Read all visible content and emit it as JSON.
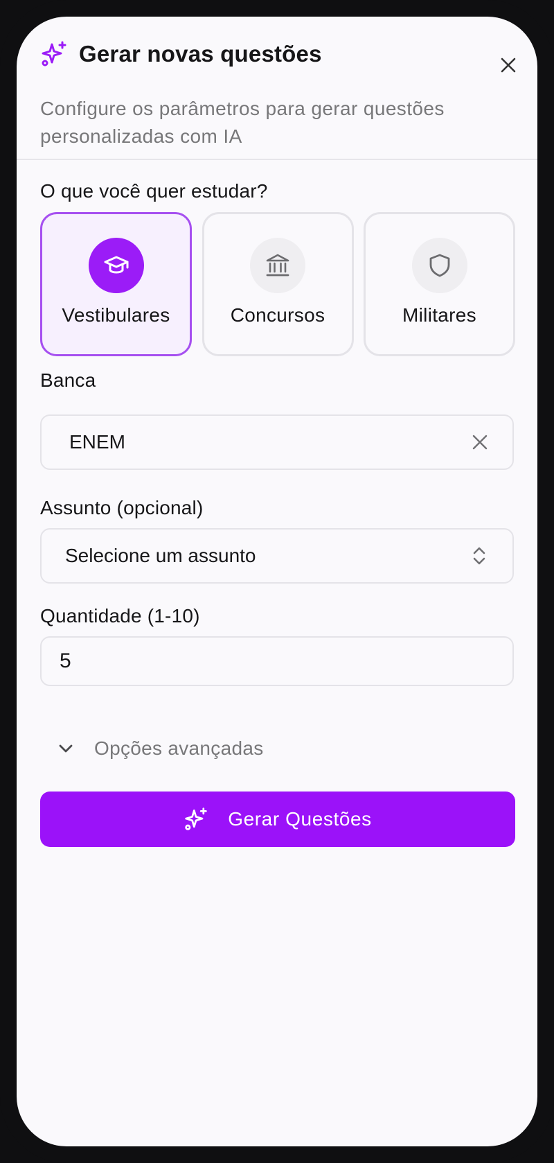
{
  "dialog": {
    "title": "Gerar novas questões",
    "subtitle": "Configure os parâmetros para gerar questões personalizadas com IA"
  },
  "study_type": {
    "label": "O que você quer estudar?",
    "options": [
      {
        "label": "Vestibulares",
        "icon": "graduation-cap-icon",
        "selected": true
      },
      {
        "label": "Concursos",
        "icon": "bank-building-icon",
        "selected": false
      },
      {
        "label": "Militares",
        "icon": "shield-icon",
        "selected": false
      }
    ]
  },
  "banca": {
    "label": "Banca",
    "value": "ENEM"
  },
  "assunto": {
    "label": "Assunto (opcional)",
    "placeholder": "Selecione um assunto"
  },
  "quantidade": {
    "label": "Quantidade (1-10)",
    "value": "5"
  },
  "advanced": {
    "label": "Opções avançadas"
  },
  "submit": {
    "label": "Gerar Questões"
  },
  "colors": {
    "accent": "#9b12f9",
    "selected_border": "#a650f0",
    "selected_bg": "#f7f0fe"
  }
}
